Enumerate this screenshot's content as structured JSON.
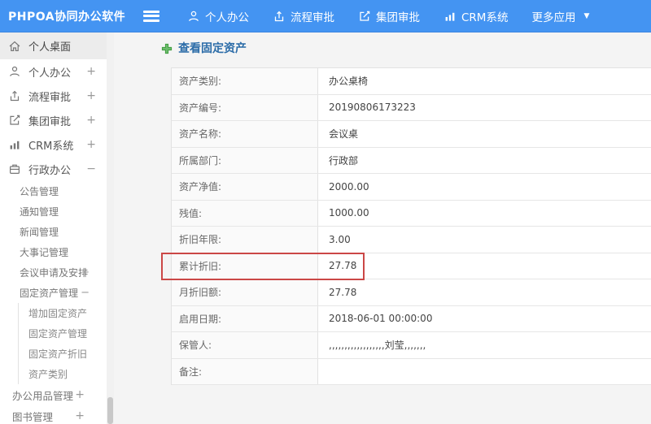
{
  "header": {
    "logo": "PHPOA协同办公软件",
    "nav": [
      {
        "label": "个人办公",
        "icon": "user-icon"
      },
      {
        "label": "流程审批",
        "icon": "workflow-icon"
      },
      {
        "label": "集团审批",
        "icon": "edit-square-icon"
      },
      {
        "label": "CRM系统",
        "icon": "bar-chart-icon"
      },
      {
        "label": "更多应用",
        "icon": "caret-down-icon"
      }
    ]
  },
  "sidebar": {
    "items": [
      {
        "label": "个人桌面",
        "icon": "home-icon",
        "active": true
      },
      {
        "label": "个人办公",
        "icon": "user-icon",
        "expand": "+"
      },
      {
        "label": "流程审批",
        "icon": "workflow-icon",
        "expand": "+"
      },
      {
        "label": "集团审批",
        "icon": "edit-square-icon",
        "expand": "+"
      },
      {
        "label": "CRM系统",
        "icon": "bar-chart-icon",
        "expand": "+"
      },
      {
        "label": "行政办公",
        "icon": "briefcase-icon",
        "expand": "−"
      }
    ],
    "admin_children": [
      {
        "label": "公告管理"
      },
      {
        "label": "通知管理"
      },
      {
        "label": "新闻管理"
      },
      {
        "label": "大事记管理"
      },
      {
        "label": "会议申请及安排",
        "expand": "+"
      },
      {
        "label": "固定资产管理",
        "expand": "−"
      }
    ],
    "asset_children": [
      {
        "label": "增加固定资产"
      },
      {
        "label": "固定资产管理"
      },
      {
        "label": "固定资产折旧"
      },
      {
        "label": "资产类别"
      }
    ],
    "other_items": [
      {
        "label": "办公用品管理",
        "expand": "+"
      },
      {
        "label": "图书管理",
        "expand": "+"
      }
    ]
  },
  "main": {
    "title": "查看固定资产",
    "fields": [
      {
        "label": "资产类别:",
        "value": "办公桌椅"
      },
      {
        "label": "资产编号:",
        "value": "20190806173223"
      },
      {
        "label": "资产名称:",
        "value": "会议桌"
      },
      {
        "label": "所属部门:",
        "value": "行政部"
      },
      {
        "label": "资产净值:",
        "value": "2000.00"
      },
      {
        "label": "残值:",
        "value": "1000.00"
      },
      {
        "label": "折旧年限:",
        "value": "3.00"
      },
      {
        "label": "累计折旧:",
        "value": "27.78"
      },
      {
        "label": "月折旧额:",
        "value": "27.78"
      },
      {
        "label": "启用日期:",
        "value": "2018-06-01 00:00:00"
      },
      {
        "label": "保管人:",
        "value": ",,,,,,,,,,,,,,,,,,刘莹,,,,,,,"
      },
      {
        "label": "备注:",
        "value": ""
      }
    ],
    "highlight": {
      "field": "累计折旧",
      "border_color": "#cb4746"
    }
  },
  "colors": {
    "header_bg": "#4494f2",
    "sidebar_active_bg": "#ececec",
    "title_blue": "#2b6ca8",
    "plus_green": "#5db35d",
    "table_border": "#e2e2e2",
    "highlight_red": "#cb4746"
  }
}
